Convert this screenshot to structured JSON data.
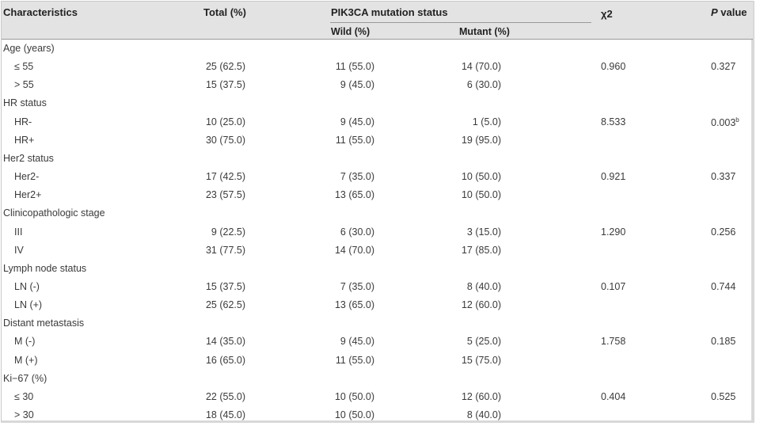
{
  "table": {
    "headers": {
      "characteristics": "Characteristics",
      "total": "Total (%)",
      "pik3ca": "PIK3CA mutation status",
      "wild": "Wild (%)",
      "mutant": "Mutant (%)",
      "chi": "χ2",
      "p_italic": "P",
      "p_rest": "value"
    },
    "groups": [
      {
        "label": "Age (years)",
        "chi": "0.960",
        "p": "0.327",
        "p_sup": "",
        "rows": [
          {
            "label": "≤ 55",
            "total": "25 (62.5)",
            "wild": "11 (55.0)",
            "mutant": "14 (70.0)"
          },
          {
            "label": "> 55",
            "total": "15 (37.5)",
            "wild": "9 (45.0)",
            "mutant": "6 (30.0)"
          }
        ]
      },
      {
        "label": "HR status",
        "chi": "8.533",
        "p": "0.003",
        "p_sup": "b",
        "rows": [
          {
            "label": "HR-",
            "total": "10 (25.0)",
            "wild": "9 (45.0)",
            "mutant": "1 (5.0)"
          },
          {
            "label": "HR+",
            "total": "30 (75.0)",
            "wild": "11 (55.0)",
            "mutant": "19 (95.0)"
          }
        ]
      },
      {
        "label": "Her2 status",
        "chi": "0.921",
        "p": "0.337",
        "p_sup": "",
        "rows": [
          {
            "label": "Her2-",
            "total": "17 (42.5)",
            "wild": "7 (35.0)",
            "mutant": "10 (50.0)"
          },
          {
            "label": "Her2+",
            "total": "23 (57.5)",
            "wild": "13 (65.0)",
            "mutant": "10 (50.0)"
          }
        ]
      },
      {
        "label": "Clinicopathologic stage",
        "chi": "1.290",
        "p": "0.256",
        "p_sup": "",
        "rows": [
          {
            "label": "III",
            "total": "9 (22.5)",
            "wild": "6 (30.0)",
            "mutant": "3 (15.0)"
          },
          {
            "label": "IV",
            "total": "31 (77.5)",
            "wild": "14 (70.0)",
            "mutant": "17 (85.0)"
          }
        ]
      },
      {
        "label": "Lymph node status",
        "chi": "0.107",
        "p": "0.744",
        "p_sup": "",
        "rows": [
          {
            "label": "LN (-)",
            "total": "15 (37.5)",
            "wild": "7 (35.0)",
            "mutant": "8 (40.0)"
          },
          {
            "label": "LN (+)",
            "total": "25 (62.5)",
            "wild": "13 (65.0)",
            "mutant": "12 (60.0)"
          }
        ]
      },
      {
        "label": "Distant metastasis",
        "chi": "1.758",
        "p": "0.185",
        "p_sup": "",
        "rows": [
          {
            "label": "M (-)",
            "total": "14 (35.0)",
            "wild": "9 (45.0)",
            "mutant": "5 (25.0)"
          },
          {
            "label": "M (+)",
            "total": "16 (65.0)",
            "wild": "11 (55.0)",
            "mutant": "15 (75.0)"
          }
        ]
      },
      {
        "label": "Ki−67 (%)",
        "chi": "0.404",
        "p": "0.525",
        "p_sup": "",
        "rows": [
          {
            "label": "≤ 30",
            "total": "22 (55.0)",
            "wild": "10 (50.0)",
            "mutant": "12 (60.0)"
          },
          {
            "label": "> 30",
            "total": "18 (45.0)",
            "wild": "10 (50.0)",
            "mutant": "8 (40.0)"
          }
        ]
      }
    ]
  }
}
